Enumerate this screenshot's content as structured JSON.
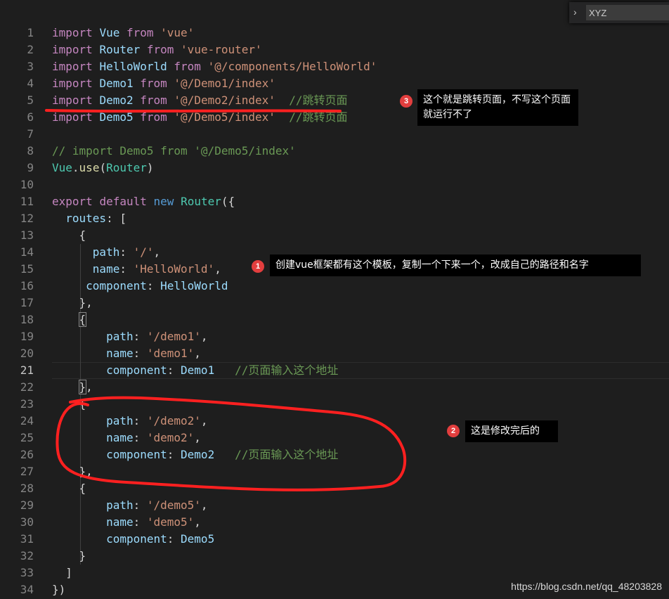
{
  "find": {
    "value": "XYZ"
  },
  "lines": [
    [
      [
        "kw",
        "import"
      ],
      [
        "pn",
        " "
      ],
      [
        "id",
        "Vue"
      ],
      [
        "pn",
        " "
      ],
      [
        "kw",
        "from"
      ],
      [
        "pn",
        " "
      ],
      [
        "str",
        "'vue'"
      ]
    ],
    [
      [
        "kw",
        "import"
      ],
      [
        "pn",
        " "
      ],
      [
        "id",
        "Router"
      ],
      [
        "pn",
        " "
      ],
      [
        "kw",
        "from"
      ],
      [
        "pn",
        " "
      ],
      [
        "str",
        "'vue-router'"
      ]
    ],
    [
      [
        "kw",
        "import"
      ],
      [
        "pn",
        " "
      ],
      [
        "id",
        "HelloWorld"
      ],
      [
        "pn",
        " "
      ],
      [
        "kw",
        "from"
      ],
      [
        "pn",
        " "
      ],
      [
        "str",
        "'@/components/HelloWorld'"
      ]
    ],
    [
      [
        "kw",
        "import"
      ],
      [
        "pn",
        " "
      ],
      [
        "id",
        "Demo1"
      ],
      [
        "pn",
        " "
      ],
      [
        "kw",
        "from"
      ],
      [
        "pn",
        " "
      ],
      [
        "str",
        "'@/Demo1/index'"
      ]
    ],
    [
      [
        "kw",
        "import"
      ],
      [
        "pn",
        " "
      ],
      [
        "id",
        "Demo2"
      ],
      [
        "pn",
        " "
      ],
      [
        "kw",
        "from"
      ],
      [
        "pn",
        " "
      ],
      [
        "str",
        "'@/Demo2/index'"
      ],
      [
        "pn",
        "  "
      ],
      [
        "cm",
        "//跳转页面"
      ]
    ],
    [
      [
        "kw",
        "import"
      ],
      [
        "pn",
        " "
      ],
      [
        "id",
        "Demo5"
      ],
      [
        "pn",
        " "
      ],
      [
        "kw",
        "from"
      ],
      [
        "pn",
        " "
      ],
      [
        "str",
        "'@/Demo5/index'"
      ],
      [
        "pn",
        "  "
      ],
      [
        "cm",
        "//跳转页面"
      ]
    ],
    [],
    [
      [
        "cm",
        "// import Demo5 from '@/Demo5/index'"
      ]
    ],
    [
      [
        "cls",
        "Vue"
      ],
      [
        "pn",
        "."
      ],
      [
        "fn",
        "use"
      ],
      [
        "pn",
        "("
      ],
      [
        "cls",
        "Router"
      ],
      [
        "pn",
        ")"
      ]
    ],
    [],
    [
      [
        "kw",
        "export"
      ],
      [
        "pn",
        " "
      ],
      [
        "kw",
        "default"
      ],
      [
        "pn",
        " "
      ],
      [
        "kb",
        "new"
      ],
      [
        "pn",
        " "
      ],
      [
        "cls",
        "Router"
      ],
      [
        "pn",
        "({"
      ]
    ],
    [
      [
        "pn",
        "  "
      ],
      [
        "id",
        "routes"
      ],
      [
        "pn",
        ": ["
      ]
    ],
    [
      [
        "pn",
        "    {"
      ]
    ],
    [
      [
        "pn",
        "      "
      ],
      [
        "id",
        "path"
      ],
      [
        "pn",
        ": "
      ],
      [
        "str",
        "'/'"
      ],
      [
        "pn",
        ","
      ]
    ],
    [
      [
        "pn",
        "      "
      ],
      [
        "id",
        "name"
      ],
      [
        "pn",
        ": "
      ],
      [
        "str",
        "'HelloWorld'"
      ],
      [
        "pn",
        ","
      ]
    ],
    [
      [
        "pn",
        "     "
      ],
      [
        "id",
        "component"
      ],
      [
        "pn",
        ": "
      ],
      [
        "id",
        "HelloWorld"
      ]
    ],
    [
      [
        "pn",
        "    },"
      ]
    ],
    [
      [
        "pn",
        "    "
      ],
      [
        "box",
        "{"
      ]
    ],
    [
      [
        "pn",
        "        "
      ],
      [
        "id",
        "path"
      ],
      [
        "pn",
        ": "
      ],
      [
        "str",
        "'/demo1'"
      ],
      [
        "pn",
        ","
      ]
    ],
    [
      [
        "pn",
        "        "
      ],
      [
        "id",
        "name"
      ],
      [
        "pn",
        ": "
      ],
      [
        "str",
        "'demo1'"
      ],
      [
        "pn",
        ","
      ]
    ],
    [
      [
        "pn",
        "        "
      ],
      [
        "id",
        "component"
      ],
      [
        "pn",
        ": "
      ],
      [
        "id",
        "Demo1"
      ],
      [
        "pn",
        "   "
      ],
      [
        "cm",
        "//页面输入这个地址"
      ]
    ],
    [
      [
        "pn",
        "    "
      ],
      [
        "box",
        "}"
      ],
      [
        "pn",
        ","
      ]
    ],
    [
      [
        "pn",
        "    {"
      ]
    ],
    [
      [
        "pn",
        "        "
      ],
      [
        "id",
        "path"
      ],
      [
        "pn",
        ": "
      ],
      [
        "str",
        "'/demo2'"
      ],
      [
        "pn",
        ","
      ]
    ],
    [
      [
        "pn",
        "        "
      ],
      [
        "id",
        "name"
      ],
      [
        "pn",
        ": "
      ],
      [
        "str",
        "'demo2'"
      ],
      [
        "pn",
        ","
      ]
    ],
    [
      [
        "pn",
        "        "
      ],
      [
        "id",
        "component"
      ],
      [
        "pn",
        ": "
      ],
      [
        "id",
        "Demo2"
      ],
      [
        "pn",
        "   "
      ],
      [
        "cm",
        "//页面输入这个地址"
      ]
    ],
    [
      [
        "pn",
        "    },"
      ]
    ],
    [
      [
        "pn",
        "    {"
      ]
    ],
    [
      [
        "pn",
        "        "
      ],
      [
        "id",
        "path"
      ],
      [
        "pn",
        ": "
      ],
      [
        "str",
        "'/demo5'"
      ],
      [
        "pn",
        ","
      ]
    ],
    [
      [
        "pn",
        "        "
      ],
      [
        "id",
        "name"
      ],
      [
        "pn",
        ": "
      ],
      [
        "str",
        "'demo5'"
      ],
      [
        "pn",
        ","
      ]
    ],
    [
      [
        "pn",
        "        "
      ],
      [
        "id",
        "component"
      ],
      [
        "pn",
        ": "
      ],
      [
        "id",
        "Demo5"
      ]
    ],
    [
      [
        "pn",
        "    }"
      ]
    ],
    [
      [
        "pn",
        "  ]"
      ]
    ],
    [
      [
        "pn",
        "})"
      ]
    ]
  ],
  "active_line": 21,
  "annotations": [
    {
      "badge": "3",
      "text": "这个就是跳转页面，不写这个页面就运行不了"
    },
    {
      "badge": "1",
      "text": "创建vue框架都有这个模板，复制一个下来一个，改成自己的路径和名字"
    },
    {
      "badge": "2",
      "text": "这是修改完后的"
    }
  ],
  "watermark": "https://blog.csdn.net/qq_48203828"
}
